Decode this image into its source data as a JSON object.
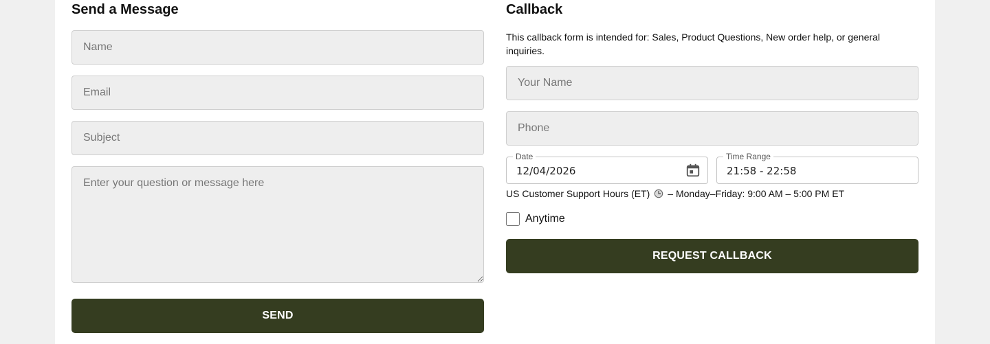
{
  "message_form": {
    "title": "Send a Message",
    "name_placeholder": "Name",
    "email_placeholder": "Email",
    "subject_placeholder": "Subject",
    "message_placeholder": "Enter your question or message here",
    "send_label": "SEND"
  },
  "callback_form": {
    "title": "Callback",
    "description": "This callback form is intended for: Sales, Product Questions, New order help, or general inquiries.",
    "your_name_placeholder": "Your Name",
    "phone_placeholder": "Phone",
    "date_label": "Date",
    "date_value": "12/04/2026",
    "time_range_label": "Time Range",
    "time_range_value": "21:58 - 22:58",
    "support_hours_prefix": "US Customer Support Hours (ET)",
    "support_hours_text": "– Monday–Friday: 9:00 AM – 5:00 PM ET",
    "anytime_label": "Anytime",
    "anytime_checked": false,
    "submit_label": "REQUEST CALLBACK"
  },
  "icons": {
    "date": "calendar-icon",
    "hours": "clock-icon"
  },
  "colors": {
    "button_bg": "#353d20",
    "field_bg": "#eeeeee",
    "page_bg": "#f0f0f0"
  }
}
